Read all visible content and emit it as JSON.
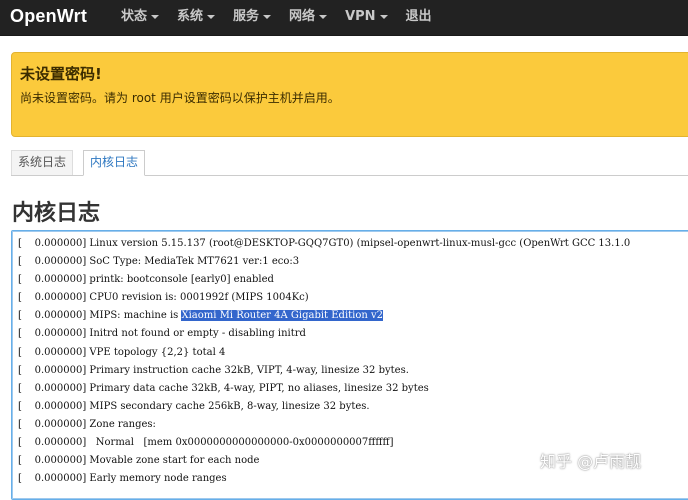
{
  "navbar": {
    "brand": "OpenWrt",
    "items": [
      {
        "label": "状态",
        "has_dropdown": true
      },
      {
        "label": "系统",
        "has_dropdown": true
      },
      {
        "label": "服务",
        "has_dropdown": true
      },
      {
        "label": "网络",
        "has_dropdown": true
      },
      {
        "label": "VPN",
        "has_dropdown": true
      },
      {
        "label": "退出",
        "has_dropdown": false
      }
    ]
  },
  "alert": {
    "title": "未设置密码!",
    "text": "尚未设置密码。请为 root 用户设置密码以保护主机并启用。",
    "color": "#fbca3c"
  },
  "tabs": {
    "items": [
      {
        "label": "系统日志",
        "active": false
      },
      {
        "label": "内核日志",
        "active": true
      }
    ]
  },
  "page": {
    "title": "内核日志"
  },
  "log": {
    "lines": [
      {
        "prefix": "[    0.000000] Linux version 5.15.137 (root@DESKTOP-GQQ7GT0) (mipsel-openwrt-linux-musl-gcc (OpenWrt GCC 13.1.0"
      },
      {
        "prefix": "[    0.000000] SoC Type: MediaTek MT7621 ver:1 eco:3"
      },
      {
        "prefix": "[    0.000000] printk: bootconsole [early0] enabled"
      },
      {
        "prefix": "[    0.000000] CPU0 revision is: 0001992f (MIPS 1004Kc)"
      },
      {
        "prefix": "[    0.000000] MIPS: machine is ",
        "highlight": "Xiaomi Mi Router 4A Gigabit Edition v2"
      },
      {
        "prefix": "[    0.000000] Initrd not found or empty - disabling initrd"
      },
      {
        "prefix": "[    0.000000] VPE topology {2,2} total 4"
      },
      {
        "prefix": "[    0.000000] Primary instruction cache 32kB, VIPT, 4-way, linesize 32 bytes."
      },
      {
        "prefix": "[    0.000000] Primary data cache 32kB, 4-way, PIPT, no aliases, linesize 32 bytes"
      },
      {
        "prefix": "[    0.000000] MIPS secondary cache 256kB, 8-way, linesize 32 bytes."
      },
      {
        "prefix": "[    0.000000] Zone ranges:"
      },
      {
        "prefix": "[    0.000000]   Normal   [mem 0x0000000000000000-0x0000000007ffffff]"
      },
      {
        "prefix": "[    0.000000] Movable zone start for each node"
      },
      {
        "prefix": "[    0.000000] Early memory node ranges"
      }
    ]
  },
  "watermark": {
    "text": "知乎 @卢雨靓"
  }
}
